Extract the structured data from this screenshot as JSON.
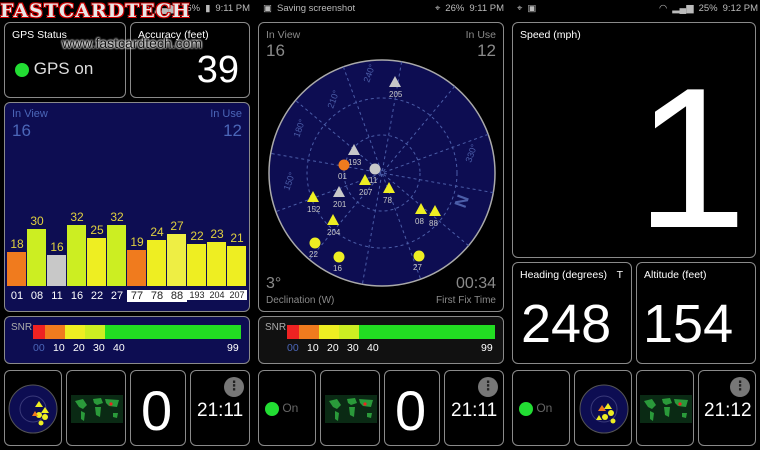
{
  "watermark": {
    "brand": "FASTCARDTECH",
    "url": "www.fastcardtech.com"
  },
  "status_bars": [
    {
      "battery": "26%",
      "time": "9:11 PM"
    },
    {
      "notification": "Saving screenshot",
      "battery": "26%",
      "time": "9:11 PM"
    },
    {
      "battery": "25%",
      "time": "9:12 PM"
    }
  ],
  "panel1": {
    "gps_status": {
      "label": "GPS Status",
      "value": "GPS on"
    },
    "accuracy": {
      "label": "Accuracy (feet)",
      "value": "39"
    },
    "satellites": {
      "in_view_label": "In View",
      "in_view": "16",
      "in_use_label": "In Use",
      "in_use": "12",
      "bars": [
        {
          "id": "01",
          "snr": 18,
          "color": "#f07b1e",
          "boxed": false
        },
        {
          "id": "08",
          "snr": 30,
          "color": "#ccee22",
          "boxed": false
        },
        {
          "id": "11",
          "snr": 16,
          "color": "#c8c8c8",
          "boxed": false
        },
        {
          "id": "16",
          "snr": 32,
          "color": "#ccee22",
          "boxed": false
        },
        {
          "id": "22",
          "snr": 25,
          "color": "#eeee22",
          "boxed": false
        },
        {
          "id": "27",
          "snr": 32,
          "color": "#ccee22",
          "boxed": false
        },
        {
          "id": "77",
          "snr": 19,
          "color": "#f07b1e",
          "boxed": true
        },
        {
          "id": "78",
          "snr": 24,
          "color": "#eeee22",
          "boxed": true
        },
        {
          "id": "88",
          "snr": 27,
          "color": "#eeee44",
          "boxed": true
        },
        {
          "id": "193",
          "snr": 22,
          "color": "#eeee22",
          "boxed": true
        },
        {
          "id": "204",
          "snr": 23,
          "color": "#eeee22",
          "boxed": true
        },
        {
          "id": "207",
          "snr": 21,
          "color": "#eeee22",
          "boxed": true
        }
      ]
    },
    "snr_legend": {
      "label": "SNR",
      "ticks": [
        "00",
        "10",
        "20",
        "30",
        "40",
        "99"
      ]
    },
    "bottom": {
      "value": "0",
      "time": "21:11"
    }
  },
  "panel2": {
    "skyview": {
      "in_view_label": "In View",
      "in_view": "16",
      "in_use_label": "In Use",
      "in_use": "12",
      "declination": "3°",
      "declination_label": "Declination (W)",
      "first_fix": "00:34",
      "first_fix_label": "First Fix Time",
      "north": "N",
      "bearings": [
        "240°",
        "210°",
        "180°",
        "150°",
        "330°"
      ],
      "sats": [
        {
          "id": "205",
          "shape": "triangle",
          "color": "#c8c8c8"
        },
        {
          "id": "193",
          "shape": "triangle",
          "color": "#c8c8c8"
        },
        {
          "id": "01",
          "shape": "circle",
          "color": "#f07b1e"
        },
        {
          "id": "11",
          "shape": "circle",
          "color": "#c8c8c8"
        },
        {
          "id": "207",
          "shape": "triangle",
          "color": "#eeee22"
        },
        {
          "id": "78",
          "shape": "triangle",
          "color": "#eeee22"
        },
        {
          "id": "201",
          "shape": "triangle",
          "color": "#c8c8c8"
        },
        {
          "id": "152",
          "shape": "triangle",
          "color": "#eeee22"
        },
        {
          "id": "204",
          "shape": "triangle",
          "color": "#eeee22"
        },
        {
          "id": "08",
          "shape": "triangle",
          "color": "#eeee22"
        },
        {
          "id": "88",
          "shape": "triangle",
          "color": "#eeee22"
        },
        {
          "id": "22",
          "shape": "circle",
          "color": "#eeee22"
        },
        {
          "id": "16",
          "shape": "circle",
          "color": "#eeee22"
        },
        {
          "id": "27",
          "shape": "circle",
          "color": "#eeee22"
        }
      ]
    },
    "snr_legend": {
      "label": "SNR",
      "ticks": [
        "00",
        "10",
        "20",
        "30",
        "40",
        "99"
      ]
    },
    "bottom": {
      "on_label": "On",
      "value": "0",
      "time": "21:11"
    }
  },
  "panel3": {
    "speed": {
      "label": "Speed (mph)",
      "value": "1"
    },
    "heading": {
      "label": "Heading (degrees)",
      "flag": "T",
      "value": "248"
    },
    "altitude": {
      "label": "Altitude (feet)",
      "value": "154"
    },
    "bottom": {
      "on_label": "On",
      "time": "21:12"
    }
  },
  "menu_glyph": "⋮",
  "colors": {
    "gps_on": "#22dd33",
    "navy": "#0d0d52",
    "label_blue": "#4b66b8",
    "snr_green": "#22dd22",
    "snr_red": "#ee2222",
    "snr_orange": "#f07b1e",
    "snr_yellow": "#eeee22"
  }
}
